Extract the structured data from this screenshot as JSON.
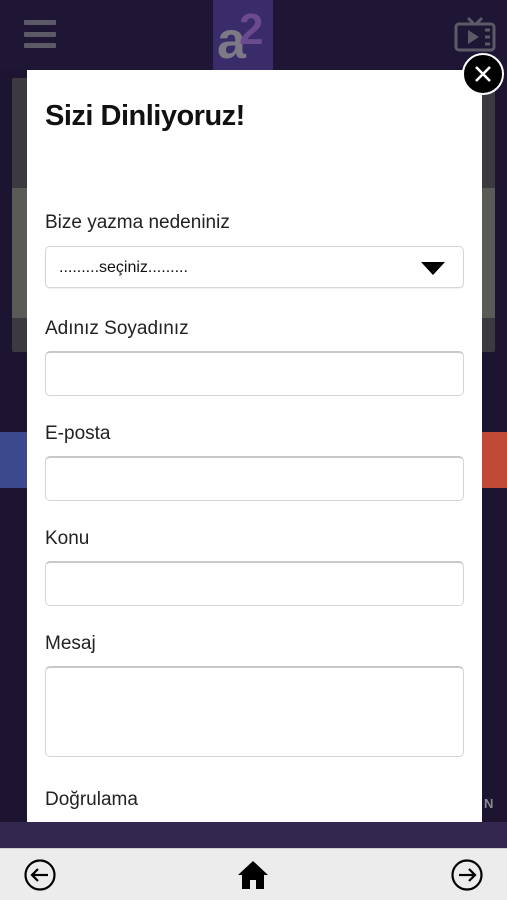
{
  "header": {
    "menu_icon": "hamburger-menu-icon",
    "logo_icon": "a2-logo-icon",
    "tv_icon": "tv-play-icon"
  },
  "modal": {
    "title": "Sizi Dinliyoruz!",
    "close_label": "X",
    "reason_label": "Bize yazma nedeniniz",
    "reason_selected": ".........seçiniz.........",
    "name_label": "Adınız Soyadınız",
    "name_value": "",
    "email_label": "E-posta",
    "email_value": "",
    "subject_label": "Konu",
    "subject_value": "",
    "message_label": "Mesaj",
    "message_value": "",
    "captcha_label": "Doğrulama"
  },
  "background": {
    "edge_letter": "N"
  },
  "bottom_nav": {
    "back_icon": "arrow-left-circle-icon",
    "home_icon": "home-icon",
    "forward_icon": "arrow-right-circle-icon"
  }
}
